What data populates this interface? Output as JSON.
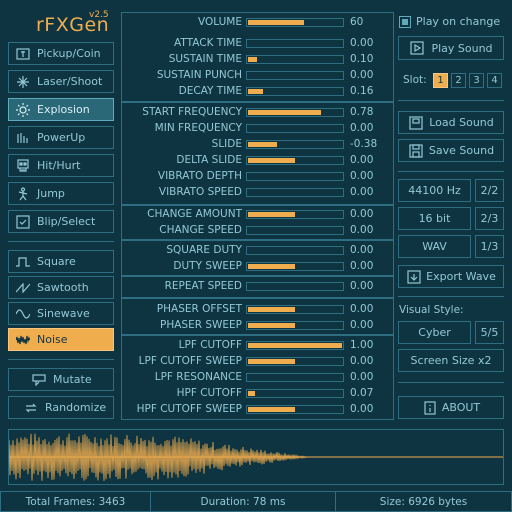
{
  "app": {
    "logo_text": "rFXGen",
    "version": "v2.5"
  },
  "colors": {
    "background": "#0f3441",
    "accent": "#f0ad4e",
    "border": "#2f6e80",
    "text": "#93c8d6",
    "selected": "#2a6777"
  },
  "generators": [
    {
      "label": "Pickup/Coin",
      "icon": "coin-icon"
    },
    {
      "label": "Laser/Shoot",
      "icon": "laser-icon"
    },
    {
      "label": "Explosion",
      "icon": "explosion-icon",
      "selected": true
    },
    {
      "label": "PowerUp",
      "icon": "powerup-icon"
    },
    {
      "label": "Hit/Hurt",
      "icon": "skull-icon"
    },
    {
      "label": "Jump",
      "icon": "jump-icon"
    },
    {
      "label": "Blip/Select",
      "icon": "blip-icon"
    }
  ],
  "waveforms": [
    {
      "label": "Square",
      "icon": "square-wave-icon"
    },
    {
      "label": "Sawtooth",
      "icon": "sawtooth-wave-icon"
    },
    {
      "label": "Sinewave",
      "icon": "sine-wave-icon"
    },
    {
      "label": "Noise",
      "icon": "noise-wave-icon",
      "selected": true
    }
  ],
  "actions": {
    "mutate": "Mutate",
    "randomize": "Randomize"
  },
  "params": [
    {
      "label": "VOLUME",
      "value": "60",
      "level": 0.6
    },
    {
      "label": "ATTACK TIME",
      "value": "0.00",
      "level": 0
    },
    {
      "label": "SUSTAIN TIME",
      "value": "0.10",
      "level": 0.1
    },
    {
      "label": "SUSTAIN PUNCH",
      "value": "0.00",
      "level": 0
    },
    {
      "label": "DECAY TIME",
      "value": "0.16",
      "level": 0.16
    },
    {
      "label": "START FREQUENCY",
      "value": "0.78",
      "level": 0.78
    },
    {
      "label": "MIN FREQUENCY",
      "value": "0.00",
      "level": 0
    },
    {
      "label": "SLIDE",
      "value": "-0.38",
      "level": 0.31
    },
    {
      "label": "DELTA SLIDE",
      "value": "0.00",
      "level": 0.5
    },
    {
      "label": "VIBRATO DEPTH",
      "value": "0.00",
      "level": 0
    },
    {
      "label": "VIBRATO SPEED",
      "value": "0.00",
      "level": 0
    },
    {
      "label": "CHANGE AMOUNT",
      "value": "0.00",
      "level": 0.5
    },
    {
      "label": "CHANGE SPEED",
      "value": "0.00",
      "level": 0
    },
    {
      "label": "SQUARE DUTY",
      "value": "0.00",
      "level": 0
    },
    {
      "label": "DUTY SWEEP",
      "value": "0.00",
      "level": 0.5
    },
    {
      "label": "REPEAT SPEED",
      "value": "0.00",
      "level": 0
    },
    {
      "label": "PHASER OFFSET",
      "value": "0.00",
      "level": 0.5
    },
    {
      "label": "PHASER SWEEP",
      "value": "0.00",
      "level": 0.5
    },
    {
      "label": "LPF CUTOFF",
      "value": "1.00",
      "level": 1
    },
    {
      "label": "LPF CUTOFF SWEEP",
      "value": "0.00",
      "level": 0.5
    },
    {
      "label": "LPF RESONANCE",
      "value": "0.00",
      "level": 0
    },
    {
      "label": "HPF CUTOFF",
      "value": "0.07",
      "level": 0.07
    },
    {
      "label": "HPF CUTOFF SWEEP",
      "value": "0.00",
      "level": 0.5
    }
  ],
  "right": {
    "play_on_change": "Play on change",
    "play_on_change_checked": true,
    "play_sound": "Play Sound",
    "slot_label": "Slot:",
    "slots": [
      "1",
      "2",
      "3",
      "4"
    ],
    "active_slot": "1",
    "load_sound": "Load Sound",
    "save_sound": "Save Sound",
    "sample_rate": "44100 Hz",
    "sample_rate_step": "2/2",
    "bit_depth": "16 bit",
    "bit_depth_step": "2/3",
    "format": "WAV",
    "format_step": "1/3",
    "export_wave": "Export Wave",
    "visual_style_label": "Visual Style:",
    "style": "Cyber",
    "style_step": "5/5",
    "screen_size": "Screen Size x2",
    "about": "ABOUT"
  },
  "status": {
    "frames": "Total Frames: 3463",
    "duration": "Duration: 78 ms",
    "size": "Size: 6926 bytes"
  }
}
